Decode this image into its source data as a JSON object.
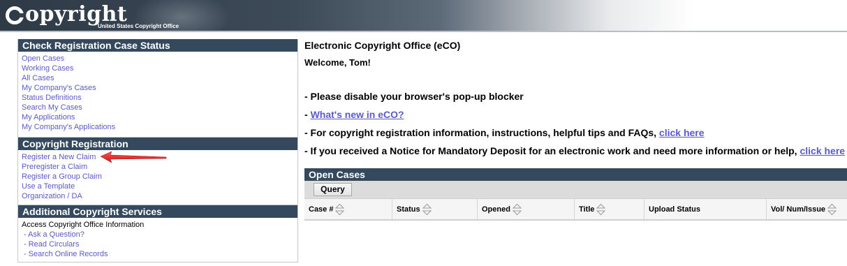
{
  "header": {
    "logo_text": "opyright",
    "logo_sub": "United States Copyright Office"
  },
  "sidebar": {
    "check_status": {
      "title": "Check Registration Case Status",
      "links": [
        "Open Cases",
        "Working Cases",
        "All Cases",
        "My Company's Cases",
        "Status Definitions",
        "Search My Cases",
        "My Applications",
        "My Company's Applications"
      ]
    },
    "registration": {
      "title": "Copyright Registration",
      "links": [
        "Register a New Claim",
        "Preregister a Claim",
        "Register a Group Claim",
        "Use a Template",
        "Organization / DA"
      ]
    },
    "additional": {
      "title": "Additional Copyright Services",
      "intro": "Access Copyright Office Information",
      "links": [
        "- Ask a Question?",
        "- Read Circulars",
        "- Search Online Records"
      ]
    }
  },
  "main": {
    "title": "Electronic Copyright Office (eCO)",
    "welcome": "Welcome, Tom!",
    "line1": "- Please disable your browser's pop-up blocker",
    "line2_prefix": "- ",
    "line2_link": "What's new in eCO?",
    "line3_text": "- For copyright registration information, instructions, helpful tips and FAQs, ",
    "line3_link": "click here",
    "line4_text": "- If you received a Notice for Mandatory Deposit for an electronic work and need more information or help, ",
    "line4_link": "click here"
  },
  "open_cases": {
    "title": "Open Cases",
    "query_label": "Query",
    "columns": [
      "Case #",
      "Status",
      "Opened",
      "Title",
      "Upload Status",
      "Vol/ Num/Issue"
    ]
  },
  "colors": {
    "panel_header": "#34495e",
    "link": "#5a5ac8",
    "arrow": "#e01818"
  }
}
